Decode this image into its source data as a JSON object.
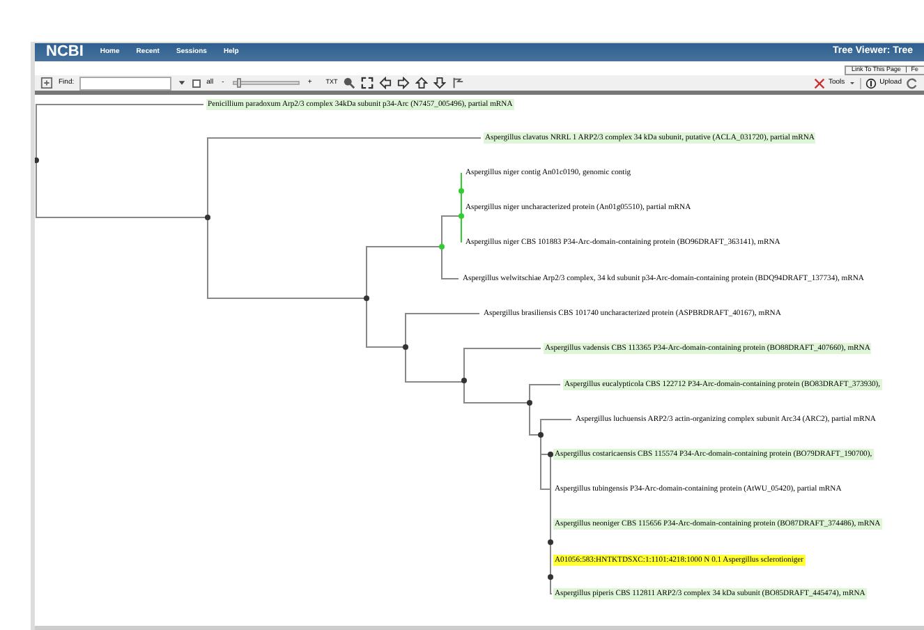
{
  "header": {
    "logo": "NCBI",
    "nav": [
      "Home",
      "Recent",
      "Sessions",
      "Help"
    ],
    "title": "Tree Viewer: Tree"
  },
  "link_bar": {
    "link": "Link To This Page",
    "separator": "|",
    "link_2": "Fe"
  },
  "toolbar": {
    "find_label": "Find:",
    "all_label": "all",
    "all_checked": false,
    "zoom_minus": "-",
    "zoom_plus": "+",
    "zoom": {
      "level": 0.05
    },
    "txt_button": "TXT",
    "tools": "Tools",
    "upload": "Upload"
  },
  "tree": {
    "leaves": [
      {
        "label": "Penicillium paradoxum Arp2/3 complex 34kDa subunit p34-Arc (N7457_005496), partial mRNA",
        "color": "#dff5d8"
      },
      {
        "label": "Aspergillus clavatus NRRL 1 ARP2/3 complex 34 kDa subunit, putative (ACLA_031720), partial mRNA",
        "color": "#dff5d8"
      },
      {
        "label": "Aspergillus niger contig An01c0190, genomic contig"
      },
      {
        "label": "Aspergillus niger uncharacterized protein (An01g05510), partial mRNA"
      },
      {
        "label": "Aspergillus niger CBS 101883 P34-Arc-domain-containing protein (BO96DRAFT_363141), mRNA"
      },
      {
        "label": "Aspergillus welwitschiae Arp2/3 complex, 34 kd subunit p34-Arc-domain-containing protein (BDQ94DRAFT_137734), mRNA"
      },
      {
        "label": "Aspergillus brasiliensis CBS 101740 uncharacterized protein (ASPBRDRAFT_40167), mRNA"
      },
      {
        "label": "Aspergillus vadensis CBS 113365 P34-Arc-domain-containing protein (BO88DRAFT_407660), mRNA",
        "color": "#dff5d8"
      },
      {
        "label": "Aspergillus eucalypticola CBS 122712 P34-Arc-domain-containing protein (BO83DRAFT_373930),",
        "color": "#dff5d8"
      },
      {
        "label": "Aspergillus luchuensis ARP2/3 actin-organizing complex subunit Arc34 (ARC2), partial mRNA"
      },
      {
        "label": "Aspergillus costaricaensis CBS 115574 P34-Arc-domain-containing protein (BO79DRAFT_190700),",
        "color": "#dff5d8"
      },
      {
        "label": "Aspergillus tubingensis P34-Arc-domain-containing protein (AtWU_05420), partial mRNA"
      },
      {
        "label": "Aspergillus neoniger CBS 115656 P34-Arc-domain-containing protein (BO87DRAFT_374486), mRNA",
        "color": "#dff5d8"
      },
      {
        "label": "A01056:583:HNTKTDSXC:1:1101:4218:1000 N 0.1 Aspergillus sclerotioniger",
        "color": "#ffff33"
      },
      {
        "label": "Aspergillus piperis CBS 112811 ARP2/3 complex 34 kDa subunit (BO85DRAFT_445474), mRNA",
        "color": "#dff5d8"
      }
    ]
  }
}
